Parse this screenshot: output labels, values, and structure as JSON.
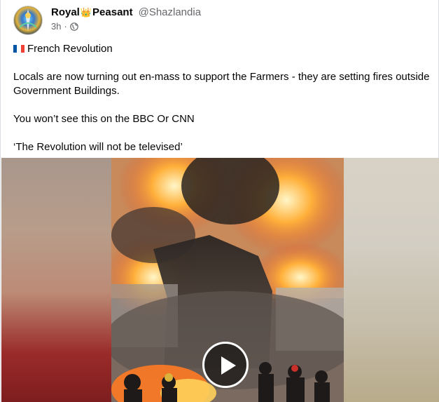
{
  "post": {
    "author_first": "Royal",
    "author_crown": "👑",
    "author_last": "Peasant",
    "handle": "@Shazlandia",
    "time": "3h",
    "separator": "·",
    "visibility_icon": "globe-icon",
    "flag_emoji_name": "france-flag",
    "lines": [
      "French Revolution",
      "Locals are now turning out en-mass to support the Farmers - they are setting fires outside Government Buildings.",
      "You won’t see this on the BBC Or CNN",
      "‘The Revolution will not be televised’"
    ]
  },
  "media": {
    "type": "video",
    "play_icon": "play-icon"
  },
  "colors": {
    "text": "#050505",
    "secondary": "#65676b",
    "flag_blue": "#0055a4",
    "flag_red": "#ef4135"
  }
}
